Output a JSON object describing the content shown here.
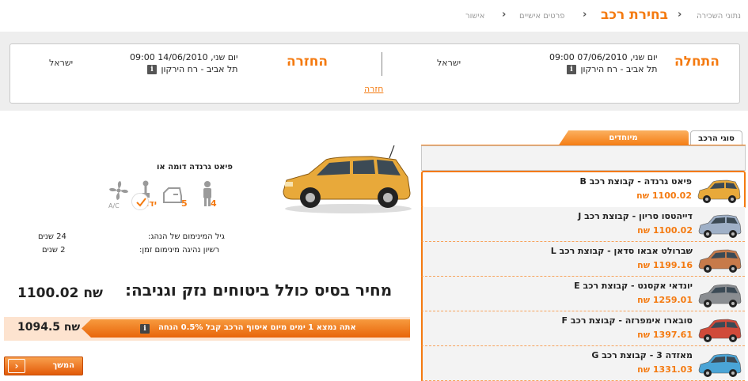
{
  "breadcrumb": {
    "step1": "נתוני השכירה",
    "step2": "בחירת רכב",
    "step3": "פרטים אישיים",
    "step4": "אישור"
  },
  "trip": {
    "pickup_title": "התחלה",
    "pickup_datetime": "יום שני, 07/06/2010 09:00",
    "pickup_location": "תל אביב - רח הירקון",
    "pickup_country": "ישראל",
    "return_title": "החזרה",
    "return_datetime": "יום שני, 14/06/2010 09:00",
    "return_location": "תל אביב - רח הירקון",
    "return_country": "ישראל",
    "back_link": "חזרה",
    "info_glyph": "i"
  },
  "tabs": {
    "car_types": "סוגי הרכב",
    "specials": "מיוחדים"
  },
  "cars": [
    {
      "name": "פיאט גרנדה - קבוצת רכב  B",
      "price": "1100.02 שח",
      "color": "#e8a93a"
    },
    {
      "name": "דייהטסו סריון - קבוצת רכב  J",
      "price": "1100.02 שח",
      "color": "#9fb0c7"
    },
    {
      "name": "שברולט אבאו סדאן - קבוצת רכב  L",
      "price": "1199.16 שח",
      "color": "#c77a4a"
    },
    {
      "name": "יונדאי אקסנט - קבוצת רכב  E",
      "price": "1259.01 שח",
      "color": "#8a8d91"
    },
    {
      "name": "סובארו אימפרזה - קבוצת רכב  F",
      "price": "1397.61 שח",
      "color": "#d04a3a"
    },
    {
      "name": "מאזדה 3 - קבוצת רכב  G",
      "price": "1331.03 שח",
      "color": "#4aa4d6"
    }
  ],
  "detail": {
    "title": "פיאט גרנדה דומה או",
    "car_color": "#e8a93a",
    "passengers": "4",
    "doors": "5",
    "gear_label": "ידני",
    "ac_label": "A/C",
    "min_age_label": "גיל המינימום של הנהג:",
    "min_age_value": "24 שנים",
    "min_license_label": "רשיון נהיגה מינימום זמן:",
    "min_license_value": "2 שנים",
    "price_label": "מחיר בסיס כולל ביטוחים נזק וגניבה:",
    "price_value": "1100.02 שח"
  },
  "promo": {
    "text": "אתה נמצא 1 ימים מיום איסוף הרכב קבל 0.5% הנחה",
    "price": "1094.5 שח"
  },
  "next_button": "המשך",
  "next_arrow": "›",
  "accent_color": "#f47a10"
}
